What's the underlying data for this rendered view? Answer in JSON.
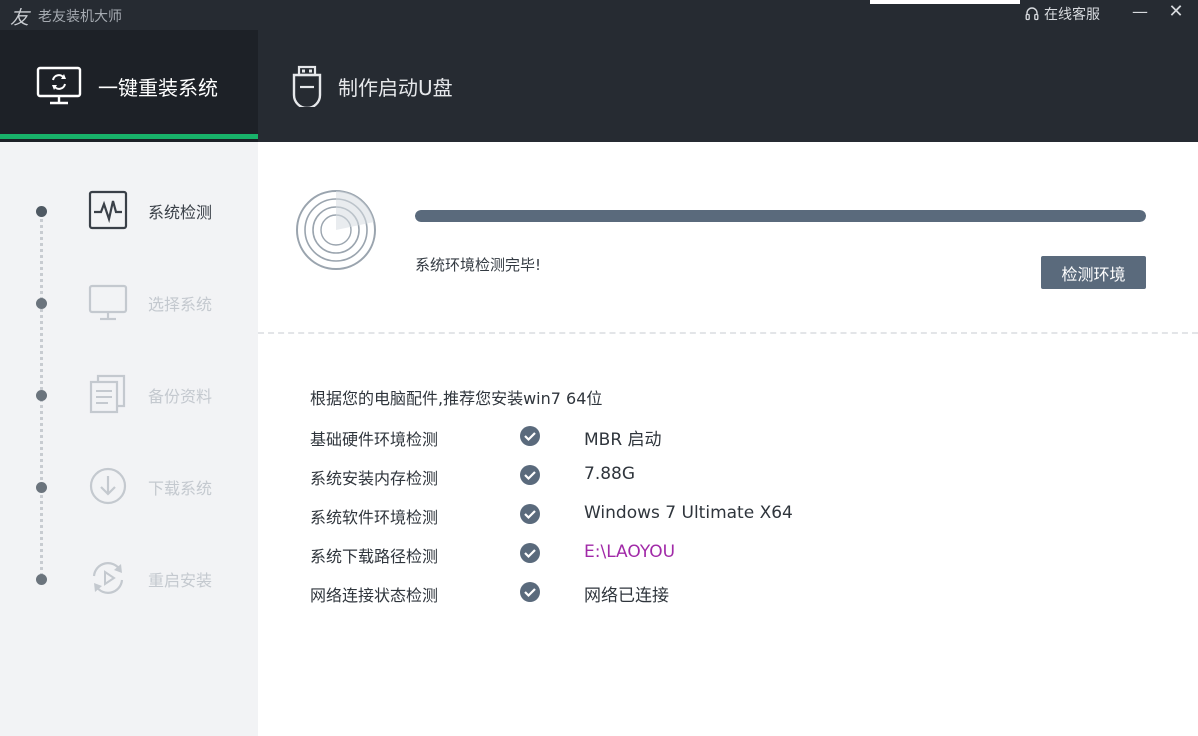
{
  "titlebar": {
    "logo_char": "友",
    "app_name": "老友装机大师",
    "support_label": "在线客服",
    "minimize_glyph": "—",
    "close_glyph": "✕"
  },
  "tabs": [
    {
      "label": "一键重装系统",
      "icon": "monitor-refresh-icon",
      "active": true
    },
    {
      "label": "制作启动U盘",
      "icon": "usb-drive-icon",
      "active": false
    }
  ],
  "steps": [
    {
      "label": "系统检测",
      "icon": "heartbeat-icon",
      "active": true
    },
    {
      "label": "选择系统",
      "icon": "monitor-icon",
      "active": false
    },
    {
      "label": "备份资料",
      "icon": "documents-icon",
      "active": false
    },
    {
      "label": "下载系统",
      "icon": "download-icon",
      "active": false
    },
    {
      "label": "重启安装",
      "icon": "restart-icon",
      "active": false
    }
  ],
  "detection": {
    "progress_fraction": 1.0,
    "status_text": "系统环境检测完毕!",
    "button_label": "检测环境"
  },
  "recommendation": "根据您的电脑配件,推荐您安装win7 64位",
  "checks": [
    {
      "label": "基础硬件环境检测",
      "value": "MBR 启动"
    },
    {
      "label": "系统安装内存检测",
      "value": "7.88G"
    },
    {
      "label": "系统软件环境检测",
      "value": "Windows 7 Ultimate X64"
    },
    {
      "label": "系统下载路径检测",
      "value": "E:\\LAOYOU"
    },
    {
      "label": "网络连接状态检测",
      "value": "网络已连接"
    }
  ],
  "colors": {
    "header_bg": "#262b32",
    "active_tab_indicator": "#18b26a",
    "accent": "#5a6a7c",
    "path_value": "#a12aa8"
  }
}
